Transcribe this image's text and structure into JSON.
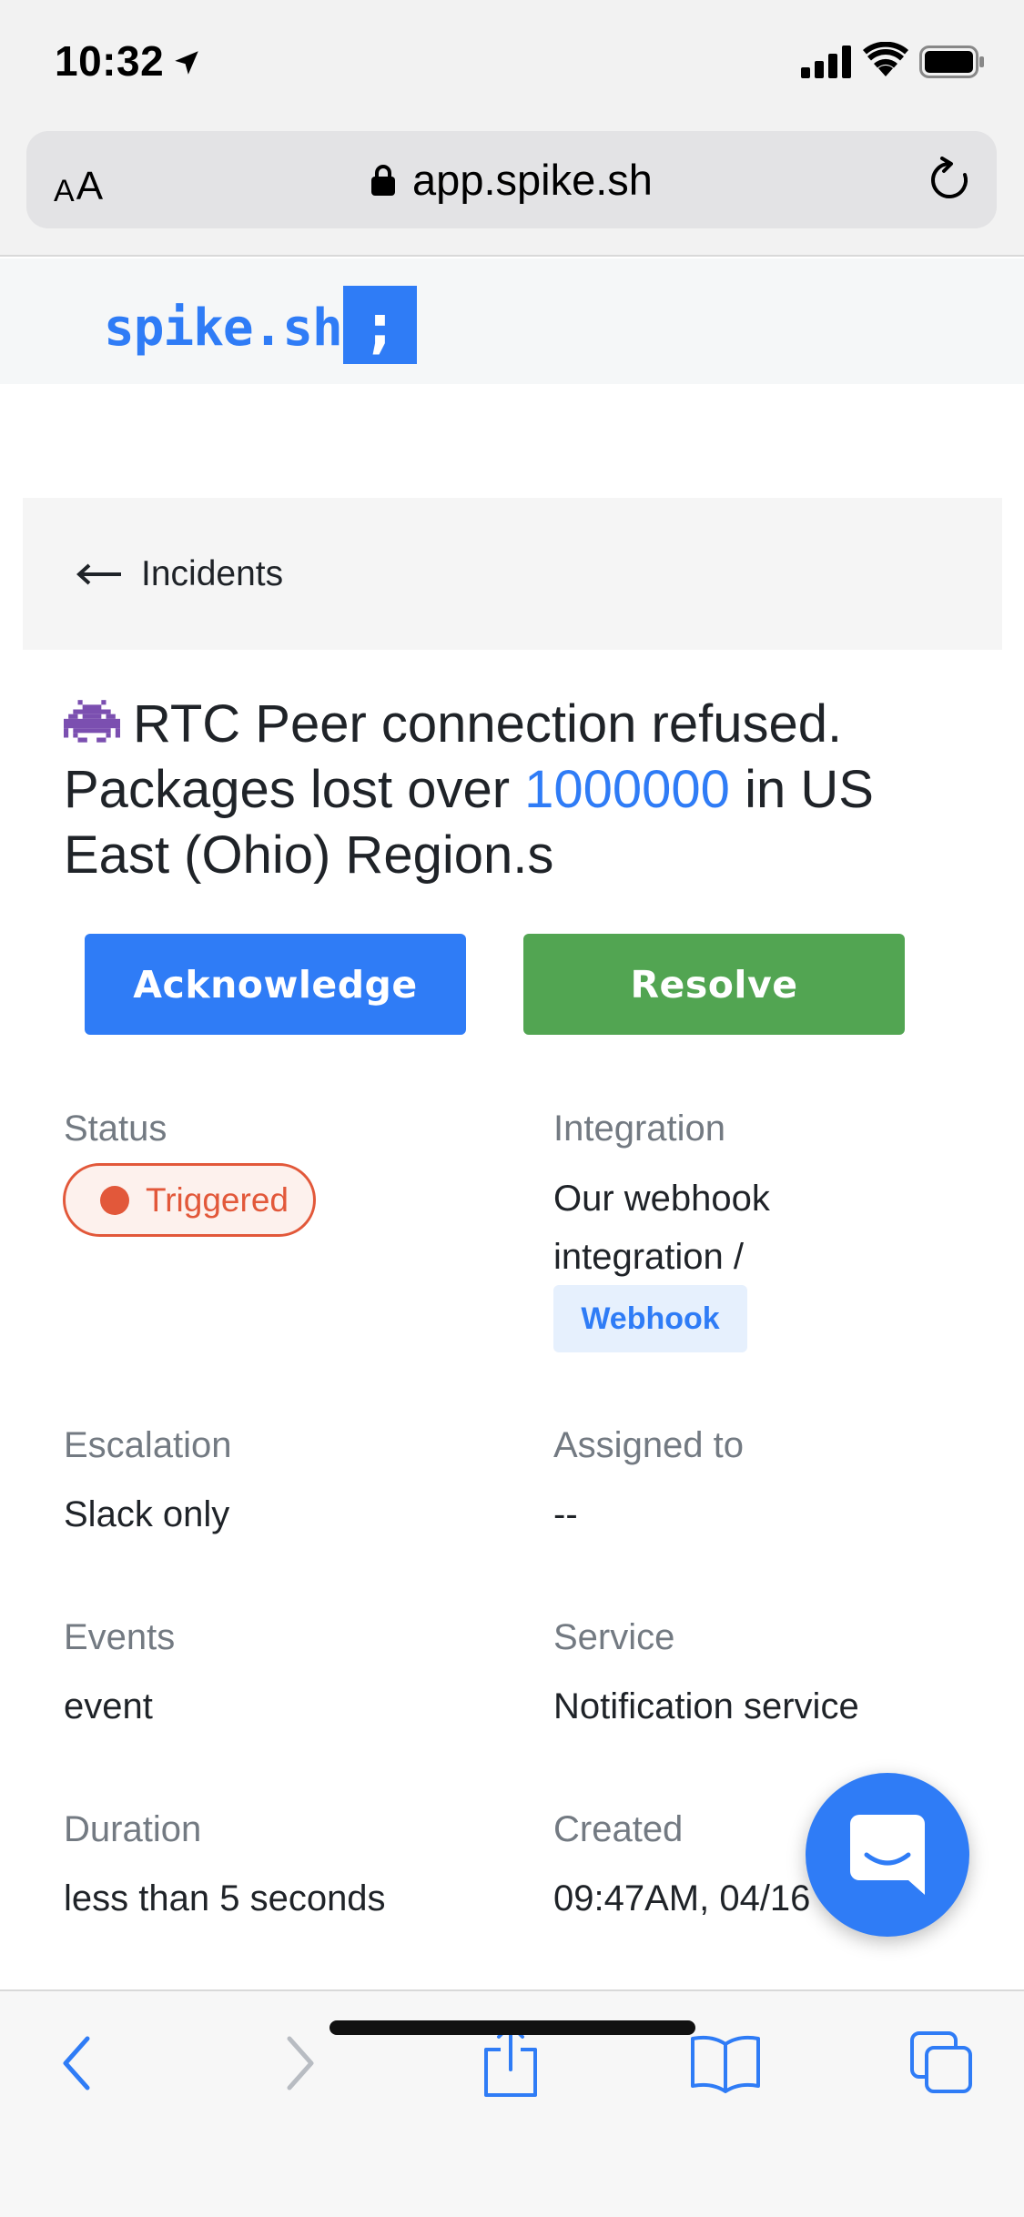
{
  "status_bar": {
    "time": "10:32"
  },
  "browser": {
    "text_size_small": "A",
    "text_size_big": "A",
    "url": "app.spike.sh"
  },
  "brand": {
    "name": "spike.sh",
    "logo_glyph": ";"
  },
  "breadcrumb": {
    "label": "Incidents"
  },
  "incident": {
    "title_part1": "RTC Peer connection refused. Packages lost over ",
    "title_number": "1000000",
    "title_part2": " in US East (Ohio) Region.s"
  },
  "actions": {
    "acknowledge": "Acknowledge",
    "resolve": "Resolve"
  },
  "details": {
    "status_label": "Status",
    "status_value": "Triggered",
    "integration_label": "Integration",
    "integration_value_line1": "Our webhook",
    "integration_value_line2": "integration /",
    "integration_tag": "Webhook",
    "escalation_label": "Escalation",
    "escalation_value": "Slack only",
    "assigned_label": "Assigned to",
    "assigned_value": "--",
    "events_label": "Events",
    "events_value": "event",
    "service_label": "Service",
    "service_value": "Notification service",
    "duration_label": "Duration",
    "duration_value": "less than 5 seconds",
    "created_label": "Created",
    "created_value": "09:47AM, 04/16"
  },
  "colors": {
    "brand_blue": "#2f7cf6",
    "resolve_green": "#52a552",
    "triggered_red": "#e2583a"
  },
  "icons": {
    "location": "location-arrow-icon",
    "signal": "cellular-signal-icon",
    "wifi": "wifi-icon",
    "battery": "battery-icon",
    "lock": "lock-icon",
    "reload": "reload-icon",
    "back_arrow": "arrow-left-icon",
    "incident_emoji": "alien-monster-icon",
    "chat": "chat-icon",
    "toolbar": [
      "back-icon",
      "forward-icon",
      "share-icon",
      "bookmarks-icon",
      "tabs-icon"
    ]
  }
}
